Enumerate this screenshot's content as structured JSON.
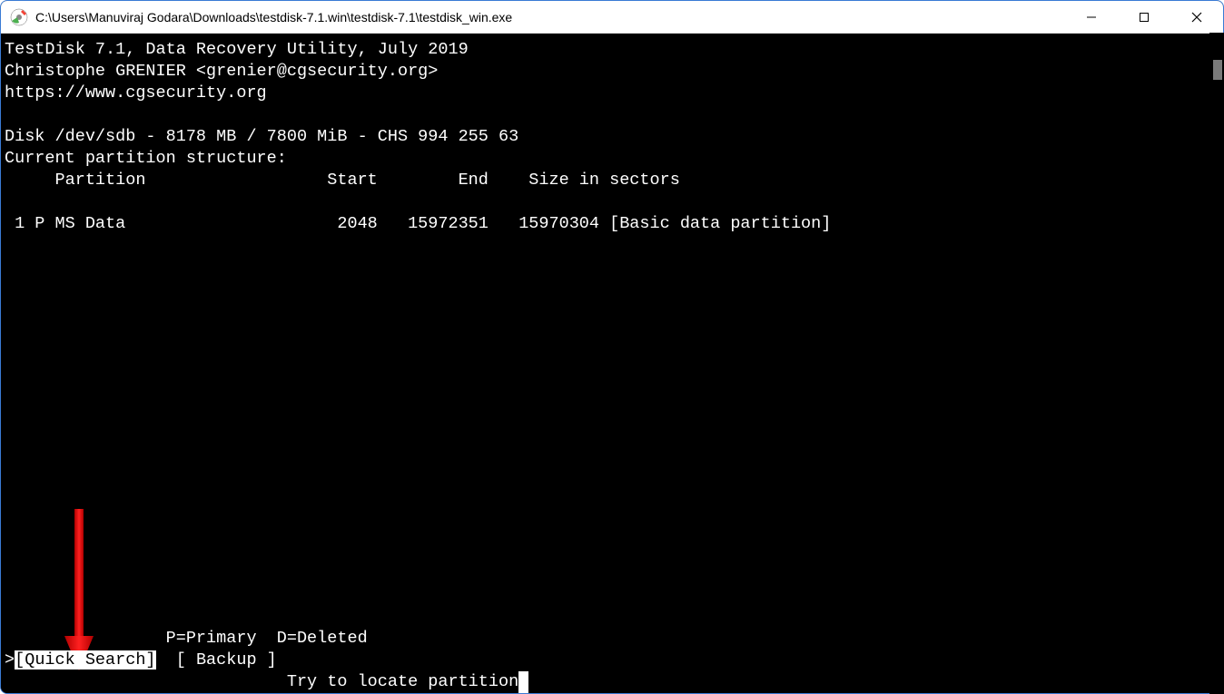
{
  "titlebar": {
    "path": "C:\\Users\\Manuviraj Godara\\Downloads\\testdisk-7.1.win\\testdisk-7.1\\testdisk_win.exe"
  },
  "header": {
    "line1": "TestDisk 7.1, Data Recovery Utility, July 2019",
    "line2": "Christophe GRENIER <grenier@cgsecurity.org>",
    "line3": "https://www.cgsecurity.org"
  },
  "disk": {
    "info": "Disk /dev/sdb - 8178 MB / 7800 MiB - CHS 994 255 63",
    "structure_label": "Current partition structure:",
    "columns": "     Partition                  Start        End    Size in sectors"
  },
  "partition_row": " 1 P MS Data                     2048   15972351   15970304 [Basic data partition]",
  "legend": "                P=Primary  D=Deleted",
  "menu": {
    "prefix": ">",
    "quick_search": "[Quick Search]",
    "backup": "  [ Backup ]"
  },
  "hint": "                            Try to locate partition",
  "icons": {
    "app": "testdisk-icon",
    "minimize": "minimize-icon",
    "maximize": "maximize-icon",
    "close": "close-icon"
  }
}
